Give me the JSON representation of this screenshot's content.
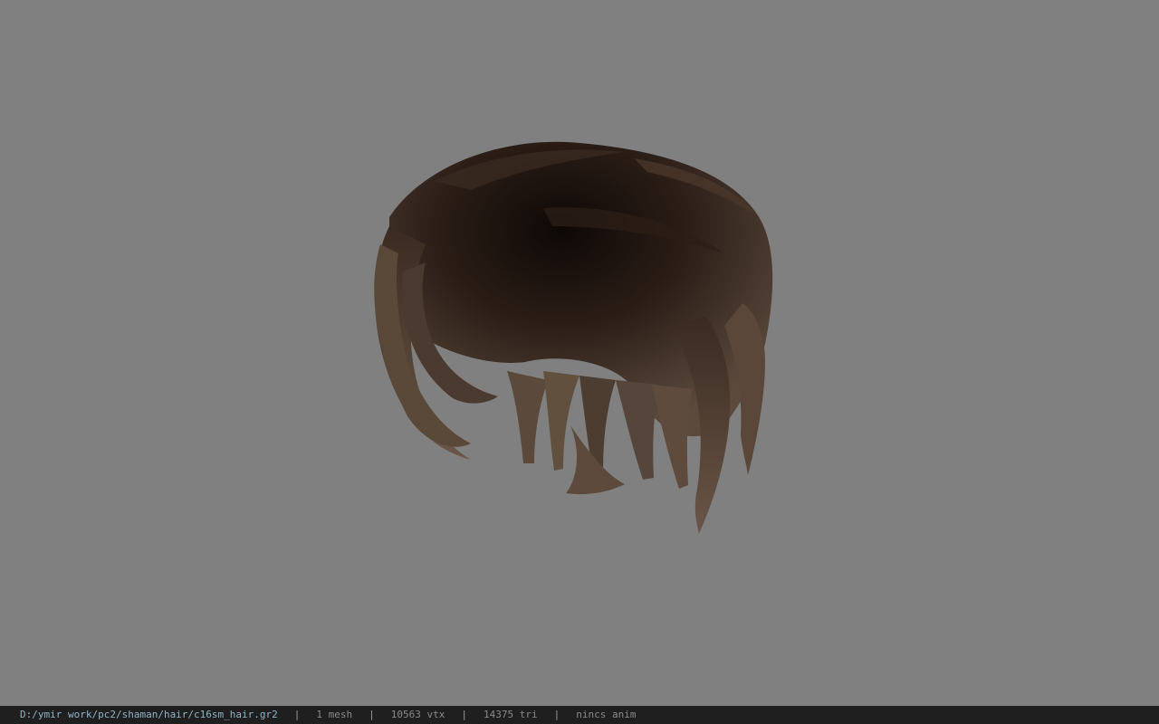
{
  "viewport": {
    "background_color": "#808080",
    "model_name": "hair-mesh",
    "model_colors": {
      "dark": "#1a110d",
      "mid": "#3b2b22",
      "light": "#6b5747"
    }
  },
  "statusbar": {
    "path": "D:/ymir work/pc2/shaman/hair/c16sm_hair.gr2",
    "sep": "|",
    "mesh": "1 mesh",
    "vtx": "10563 vtx",
    "tri": "14375 tri",
    "anim": "nincs anim",
    "path_color": "#8fb4c6"
  }
}
